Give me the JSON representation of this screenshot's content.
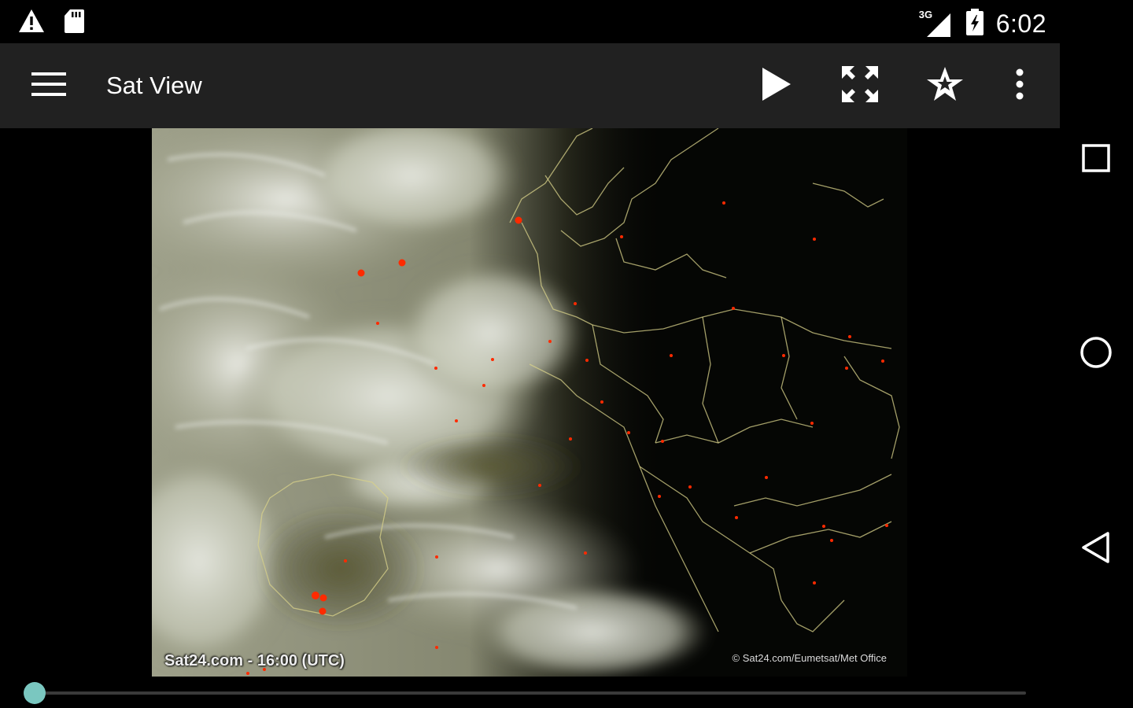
{
  "status_bar": {
    "time": "6:02",
    "network": "3G",
    "icons": [
      "warning-icon",
      "sd-card-icon",
      "signal-icon",
      "battery-icon"
    ]
  },
  "toolbar": {
    "title": "Sat View",
    "actions": [
      "menu-icon",
      "play-icon",
      "fullscreen-icon",
      "star-icon",
      "more-vert-icon"
    ]
  },
  "satellite_image": {
    "caption": "Sat24.com - 16:00 (UTC)",
    "copyright": "© Sat24.com/Eumetsat/Met Office"
  },
  "timeline": {
    "progress": 0.0
  },
  "navigation_bar": {
    "buttons": [
      "recents-icon",
      "home-icon",
      "back-icon"
    ]
  },
  "colors": {
    "toolbar_bg": "#212121",
    "accent": "#7ac7c0",
    "city_marker": "#ff2a00",
    "borders": "#d8d28a"
  }
}
